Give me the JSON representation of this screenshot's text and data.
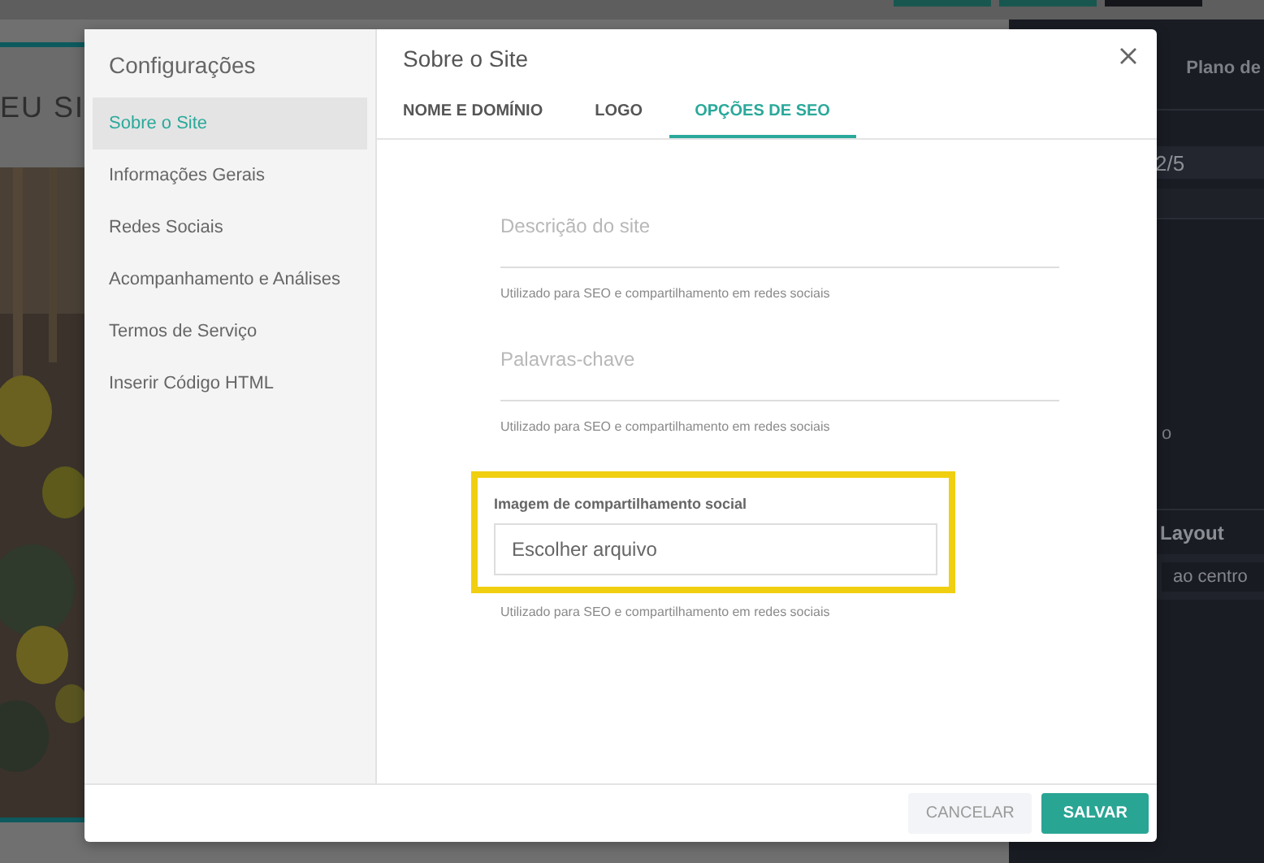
{
  "preview": {
    "heading": "EU SI"
  },
  "right_panel": {
    "tab": "Plano de",
    "counter": "2/5",
    "fragment": "o",
    "section_title": "Layout",
    "select_value": "ao centro"
  },
  "dialog": {
    "sidebar": {
      "title": "Configurações",
      "items": [
        {
          "label": "Sobre o Site",
          "selected": true
        },
        {
          "label": "Informações Gerais",
          "selected": false
        },
        {
          "label": "Redes Sociais",
          "selected": false
        },
        {
          "label": "Acompanhamento e Análises",
          "selected": false
        },
        {
          "label": "Termos de Serviço",
          "selected": false
        },
        {
          "label": "Inserir Código HTML",
          "selected": false
        }
      ]
    },
    "title": "Sobre o Site",
    "tabs": [
      {
        "label": "NOME E DOMÍNIO",
        "selected": false
      },
      {
        "label": "LOGO",
        "selected": false
      },
      {
        "label": "OPÇÕES DE SEO",
        "selected": true
      }
    ],
    "fields": [
      {
        "kind": "text",
        "placeholder": "Descrição do site",
        "help": "Utilizado para SEO e compartilhamento em redes sociais",
        "highlighted": false
      },
      {
        "kind": "text",
        "placeholder": "Palavras-chave",
        "help": "Utilizado para SEO e compartilhamento em redes sociais",
        "highlighted": false
      },
      {
        "kind": "file",
        "label": "Imagem de compartilhamento social",
        "value": "Escolher arquivo",
        "help": "Utilizado para SEO e compartilhamento em redes sociais",
        "highlighted": true
      }
    ],
    "buttons": [
      {
        "label": "CANCELAR",
        "kind": "secondary"
      },
      {
        "label": "SALVAR",
        "kind": "primary"
      }
    ]
  }
}
